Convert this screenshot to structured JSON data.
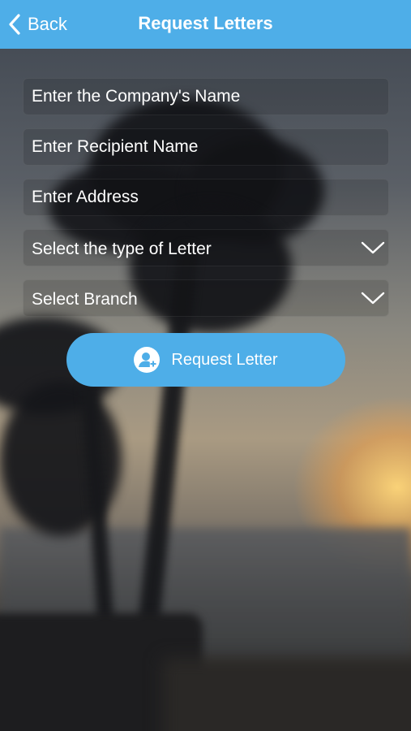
{
  "navbar": {
    "back_label": "Back",
    "title": "Request Letters"
  },
  "form": {
    "company_placeholder": "Enter the Company's Name",
    "recipient_placeholder": "Enter Recipient Name",
    "address_placeholder": "Enter Address",
    "letter_type_select": "Select the type of Letter",
    "branch_select": "Select Branch"
  },
  "actions": {
    "request_label": "Request Letter"
  },
  "icons": {
    "back": "chevron-left-icon",
    "dropdown": "chevron-down-icon",
    "request": "user-add-icon"
  },
  "colors": {
    "accent": "#4eaee8",
    "text": "#ffffff"
  }
}
